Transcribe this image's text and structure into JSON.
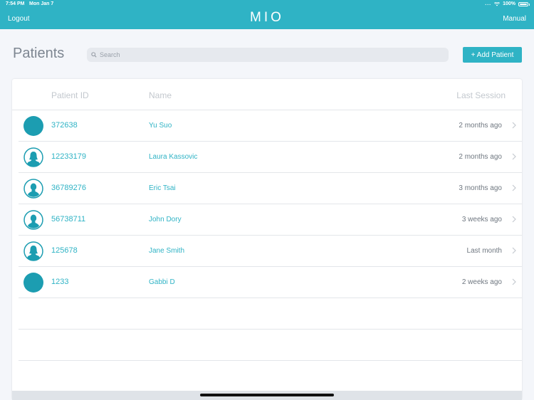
{
  "status_bar": {
    "time": "7:54 PM",
    "date": "Mon Jan 7",
    "dots": "...",
    "battery": "100%"
  },
  "nav": {
    "logout_label": "Logout",
    "brand": "MIO",
    "manual_label": "Manual"
  },
  "page": {
    "title": "Patients",
    "search_placeholder": "Search",
    "add_button_label": "+ Add Patient"
  },
  "table": {
    "columns": {
      "patient_id": "Patient ID",
      "name": "Name",
      "last_session": "Last Session"
    },
    "rows": [
      {
        "avatar": "solid-circle",
        "patient_id": "372638",
        "name": "Yu Suo",
        "last_session": "2 months ago"
      },
      {
        "avatar": "female-avatar",
        "patient_id": "12233179",
        "name": "Laura Kassovic",
        "last_session": "2 months ago"
      },
      {
        "avatar": "male-avatar",
        "patient_id": "36789276",
        "name": "Eric Tsai",
        "last_session": "3 months ago"
      },
      {
        "avatar": "male-avatar",
        "patient_id": "56738711",
        "name": "John Dory",
        "last_session": "3 weeks ago"
      },
      {
        "avatar": "female-avatar",
        "patient_id": "125678",
        "name": "Jane Smith",
        "last_session": "Last month"
      },
      {
        "avatar": "solid-circle",
        "patient_id": "1233",
        "name": "Gabbi D",
        "last_session": "2 weeks ago"
      }
    ]
  },
  "colors": {
    "accent": "#2fb3c5",
    "background": "#f4f6fa",
    "muted_text": "#6f7780"
  }
}
